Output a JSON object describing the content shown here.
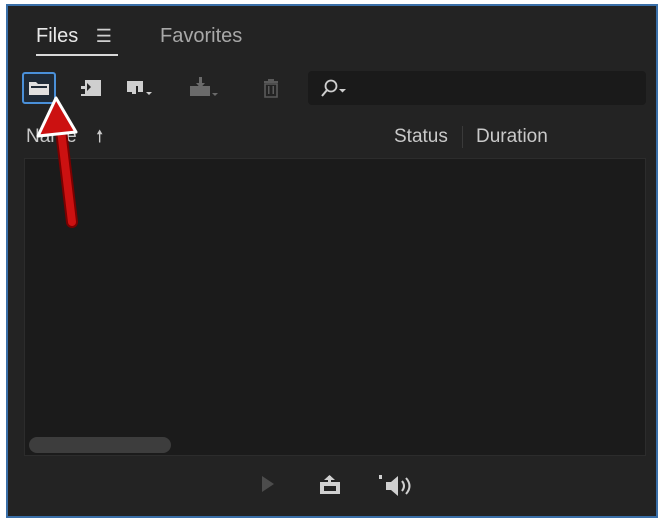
{
  "tabs": [
    {
      "label": "Files",
      "menu_icon": "hamburger-icon"
    },
    {
      "label": "Favorites"
    }
  ],
  "toolbar": {
    "buttons": [
      {
        "icon": "folder-open-icon",
        "active": true
      },
      {
        "icon": "import-icon"
      },
      {
        "icon": "new-item-dropdown-icon"
      },
      {
        "icon": "export-dropdown-icon",
        "disabled": true
      },
      {
        "icon": "trash-icon",
        "disabled": true
      }
    ],
    "search": {
      "value": "",
      "icon": "search-dropdown-icon"
    }
  },
  "table": {
    "columns": [
      "Name",
      "Status",
      "Duration"
    ],
    "sort": "ascending",
    "rows": []
  },
  "bottom_bar": {
    "buttons": [
      {
        "icon": "play-icon",
        "disabled": true
      },
      {
        "icon": "export-media-icon"
      },
      {
        "icon": "audio-speaker-icon"
      }
    ]
  },
  "annotation": {
    "icon": "red-arrow-pointer",
    "color": "#cc1111"
  },
  "colors": {
    "panel_bg": "#232323",
    "list_bg": "#1b1b1b",
    "accent": "#4a90d9",
    "frame": "#3a6fa8"
  }
}
